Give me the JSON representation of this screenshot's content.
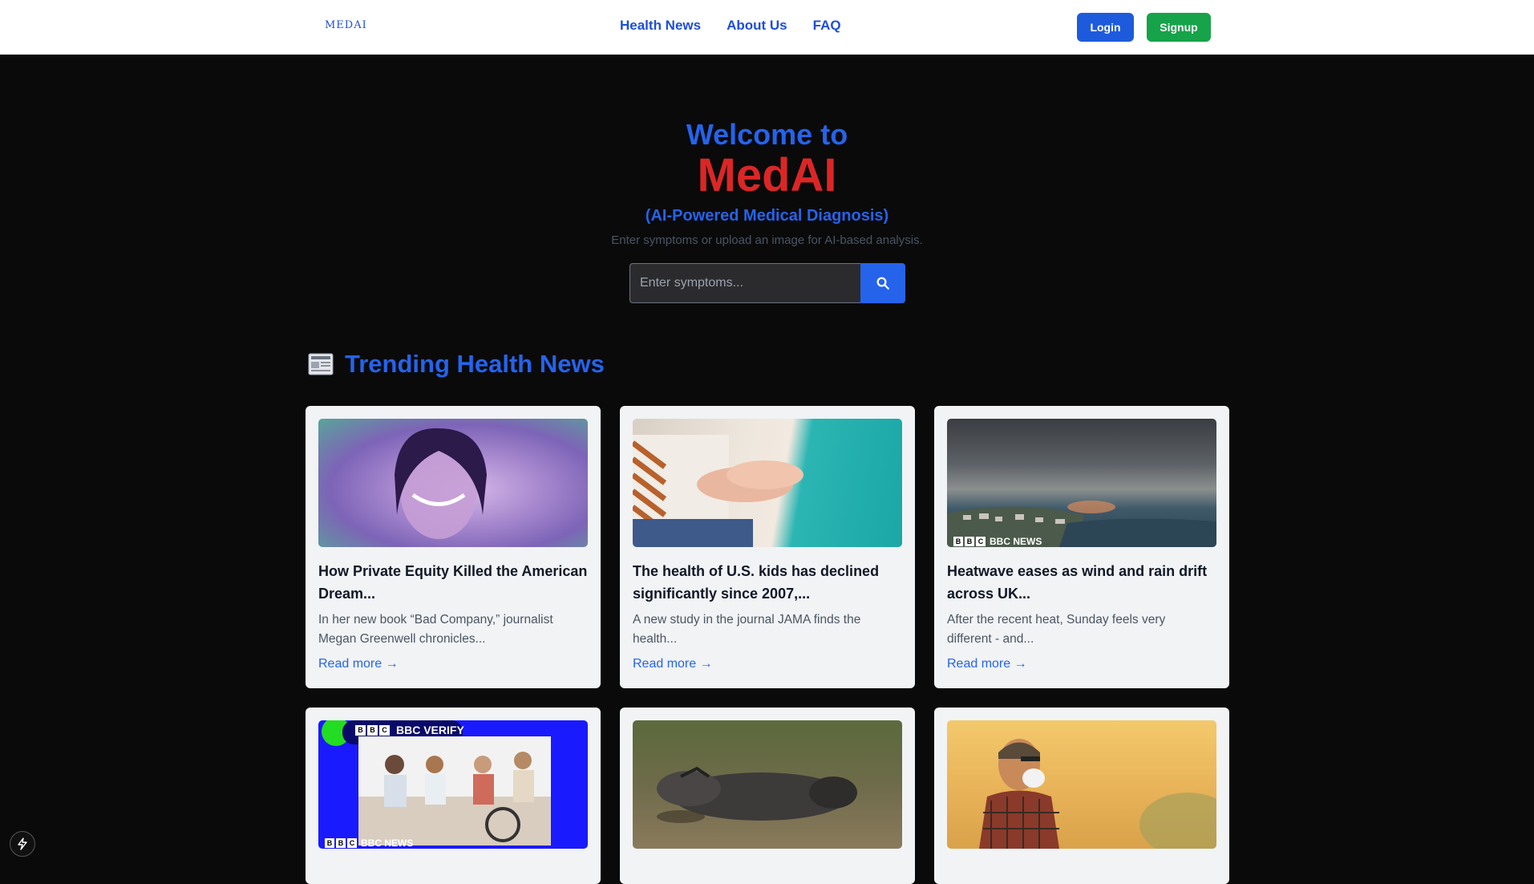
{
  "header": {
    "logo_text": "MEDAI",
    "nav": [
      "Health News",
      "About Us",
      "FAQ"
    ],
    "login_label": "Login",
    "signup_label": "Signup"
  },
  "hero": {
    "welcome": "Welcome to",
    "brand": "MedAI",
    "tagline": "(AI-Powered Medical Diagnosis)",
    "subtitle": "Enter symptoms or upload an image for AI-based analysis.",
    "search_placeholder": "Enter symptoms..."
  },
  "news": {
    "section_title": "Trending Health News",
    "section_icon": "newspaper-icon",
    "read_more": "Read more →",
    "cards": [
      {
        "title": "How Private Equity Killed the American Dream...",
        "summary": "In her new book “Bad Company,” journalist Megan Greenwell chronicles...",
        "image": "portrait-woman-purple"
      },
      {
        "title": "The health of U.S. kids has declined significantly since 2007,...",
        "summary": "A new study in the journal JAMA finds the health...",
        "image": "nurse-holding-hands"
      },
      {
        "title": "Heatwave eases as wind and rain drift across UK...",
        "summary": "After the recent heat, Sunday feels very different - and...",
        "image": "coastal-town-storm",
        "badge": "BBC NEWS"
      },
      {
        "image": "bbc-verify-office",
        "badge": "BBC NEWS",
        "overlay": "BBC VERIFY"
      },
      {
        "image": "vulture-carcass"
      },
      {
        "image": "man-mask-smoke"
      }
    ]
  },
  "colors": {
    "accent": "#2563eb",
    "brand_red": "#dc2626",
    "signup_green": "#16a34a",
    "background": "#0a0a0b"
  }
}
